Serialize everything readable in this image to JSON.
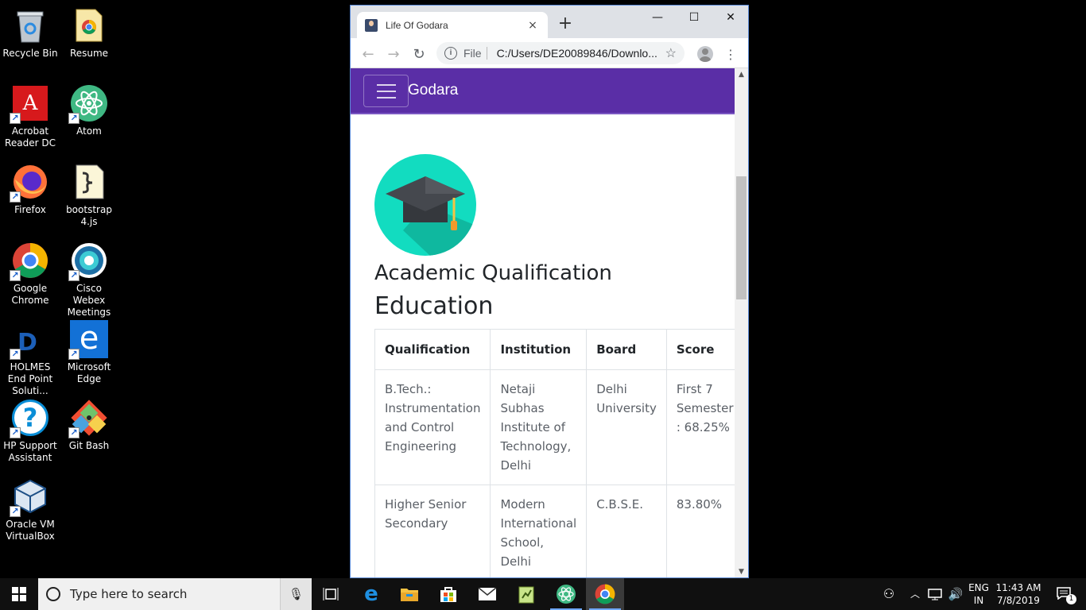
{
  "desktop": {
    "icons": [
      {
        "label": "Recycle Bin",
        "icon": "recycle-bin-icon"
      },
      {
        "label": "Resume",
        "icon": "chrome-document-icon"
      },
      {
        "label": "Acrobat Reader DC",
        "icon": "acrobat-icon"
      },
      {
        "label": "Atom",
        "icon": "atom-icon"
      },
      {
        "label": "Firefox",
        "icon": "firefox-icon"
      },
      {
        "label": "bootstrap 4.js",
        "icon": "script-file-icon"
      },
      {
        "label": "Google Chrome",
        "icon": "chrome-icon"
      },
      {
        "label": "Cisco Webex Meetings",
        "icon": "webex-icon"
      },
      {
        "label": "HOLMES End Point Soluti...",
        "icon": "holmes-icon"
      },
      {
        "label": "Microsoft Edge",
        "icon": "edge-icon"
      },
      {
        "label": "HP Support Assistant",
        "icon": "help-icon"
      },
      {
        "label": "Git Bash",
        "icon": "git-icon"
      },
      {
        "label": "Oracle VM VirtualBox",
        "icon": "virtualbox-icon"
      }
    ]
  },
  "browser": {
    "tab_title": "Life Of Godara",
    "close_tab": "×",
    "new_tab": "+",
    "scheme": "File",
    "url": "C:/Users/DE20089846/Downlo...",
    "minimize": "—",
    "maximize": "☐",
    "close": "✕"
  },
  "page": {
    "brand": "Godara",
    "section_title": "Academic Qualification",
    "heading": "Education",
    "table": {
      "headers": [
        "Qualification",
        "Institution",
        "Board",
        "Score"
      ],
      "rows": [
        [
          "B.Tech.: Instrumentation and Control Engineering",
          "Netaji Subhas Institute of Technology, Delhi",
          "Delhi University",
          "First 7 Semester : 68.25%"
        ],
        [
          "Higher Senior Secondary",
          "Modern International School, Delhi",
          "C.B.S.E.",
          "83.80%"
        ]
      ]
    }
  },
  "taskbar": {
    "search_placeholder": "Type here to search",
    "language": "ENG",
    "region": "IN",
    "time": "11:43 AM",
    "date": "7/8/2019",
    "notification_count": "1"
  },
  "colors": {
    "navbar": "#5a2ea6",
    "emblem": "#12dcc0",
    "taskbar": "#101010"
  }
}
